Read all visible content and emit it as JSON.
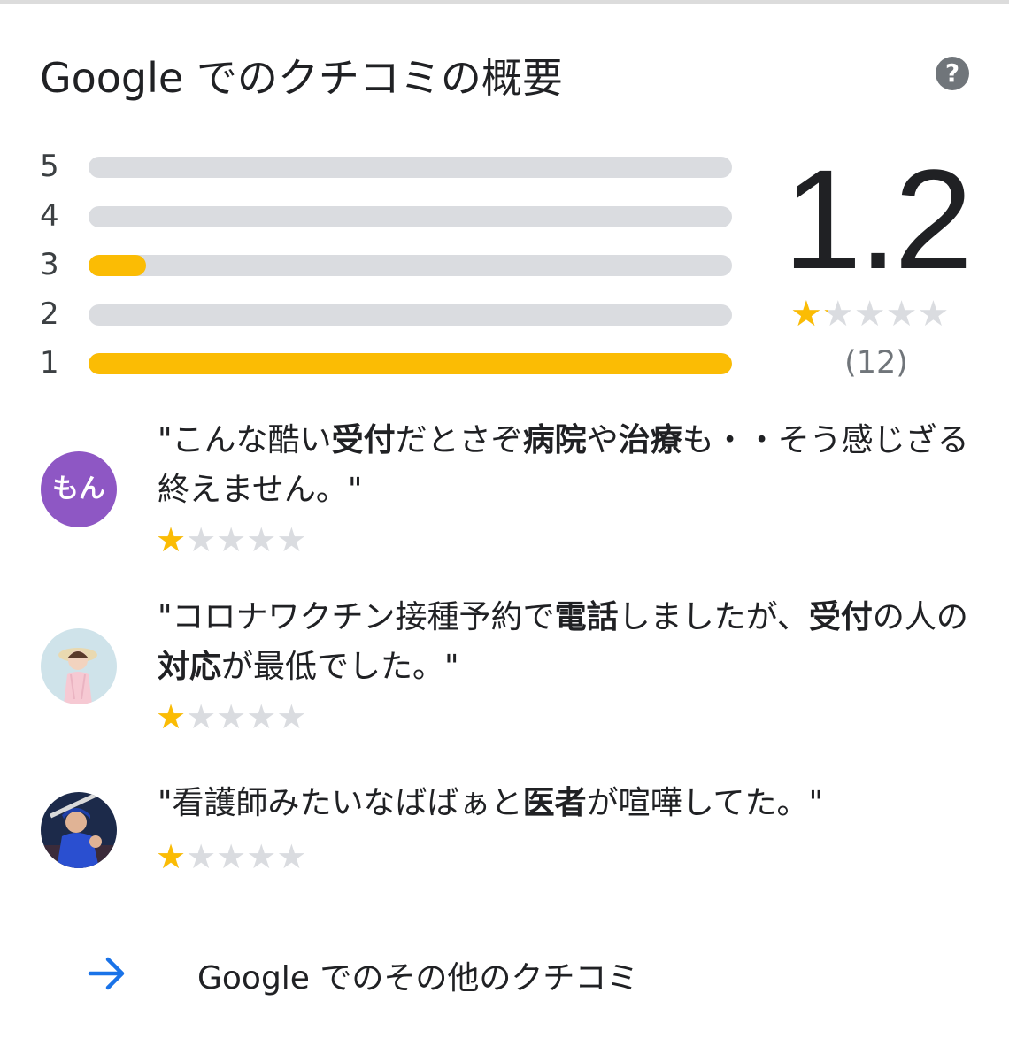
{
  "title": "Google でのクチコミの概要",
  "help_icon": "?",
  "rating": {
    "score": "1.2",
    "stars_value": 1.2,
    "review_count": "(12)"
  },
  "histogram": [
    {
      "stars": "5",
      "fraction": 0.0
    },
    {
      "stars": "4",
      "fraction": 0.0
    },
    {
      "stars": "3",
      "fraction": 0.09
    },
    {
      "stars": "2",
      "fraction": 0.0
    },
    {
      "stars": "1",
      "fraction": 1.0
    }
  ],
  "reviews": [
    {
      "avatar_type": "text",
      "avatar_text": "もん",
      "avatar_color": "#8e57c4",
      "segments": [
        {
          "text": "\"こんな酷い",
          "bold": false
        },
        {
          "text": "受付",
          "bold": true
        },
        {
          "text": "だとさぞ",
          "bold": false
        },
        {
          "text": "病院",
          "bold": true
        },
        {
          "text": "や",
          "bold": false
        },
        {
          "text": "治療",
          "bold": true
        },
        {
          "text": "も・・そう感じざる終えません。\"",
          "bold": false
        }
      ],
      "stars": 1
    },
    {
      "avatar_type": "photo",
      "avatar_icon": "person-photo-icon",
      "segments": [
        {
          "text": "\"コロナワクチン接種予約で",
          "bold": false
        },
        {
          "text": "電話",
          "bold": true
        },
        {
          "text": "しましたが、",
          "bold": false
        },
        {
          "text": "受付",
          "bold": true
        },
        {
          "text": "の人の",
          "bold": false
        },
        {
          "text": "対応",
          "bold": true
        },
        {
          "text": "が最低でした。\"",
          "bold": false
        }
      ],
      "stars": 1
    },
    {
      "avatar_type": "photo",
      "avatar_icon": "baseball-player-photo-icon",
      "segments": [
        {
          "text": "\"看護師みたいなばばぁと",
          "bold": false
        },
        {
          "text": "医者",
          "bold": true
        },
        {
          "text": "が喧嘩してた。\"",
          "bold": false
        }
      ],
      "stars": 1
    }
  ],
  "more_link": {
    "label": "Google でのその他のクチコミ",
    "icon": "arrow-right-icon"
  },
  "colors": {
    "star_filled": "#fbbc04",
    "star_empty": "#dadce0",
    "bar_track": "#dadce0",
    "accent_link": "#1a73e8"
  }
}
